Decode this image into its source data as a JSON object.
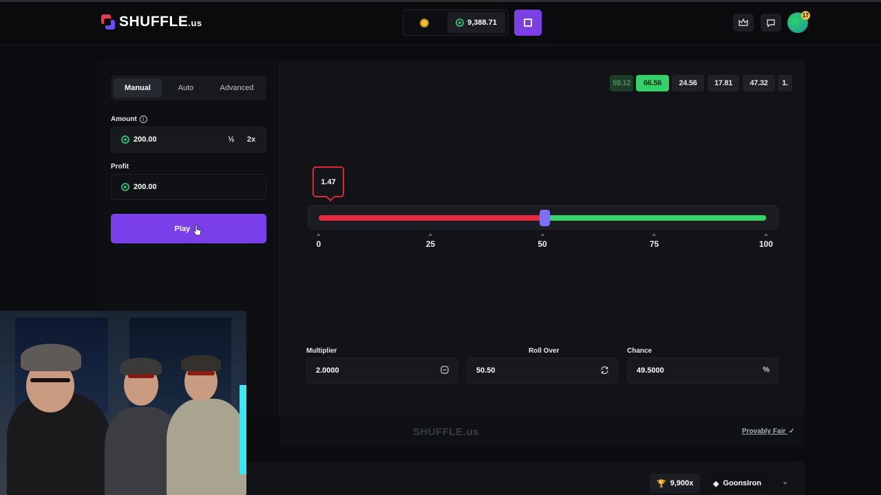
{
  "brand": {
    "name": "SHUFFLE",
    "suffix": ".us"
  },
  "wallet": {
    "balance": "9,388.71"
  },
  "avatar": {
    "level_badge": "17"
  },
  "sidebar": {
    "tabs": [
      "Manual",
      "Auto",
      "Advanced"
    ],
    "amount_label": "Amount",
    "amount_value": "200.00",
    "half_label": "½",
    "double_label": "2x",
    "profit_label": "Profit",
    "profit_value": "200.00",
    "play_label": "Play"
  },
  "history": [
    {
      "value": "59.12",
      "state": "faded"
    },
    {
      "value": "66.56",
      "state": "win"
    },
    {
      "value": "24.56",
      "state": "loss"
    },
    {
      "value": "17.81",
      "state": "loss"
    },
    {
      "value": "47.32",
      "state": "loss"
    },
    {
      "value": "1.",
      "state": "loss"
    }
  ],
  "slider": {
    "result": "1.47",
    "roll_over": 50.5,
    "ticks": [
      "0",
      "25",
      "50",
      "75",
      "100"
    ],
    "colors": {
      "lose": "#e8283d",
      "win": "#35d26a",
      "knob": "#7b6ff2"
    }
  },
  "controls": {
    "multiplier_label": "Multiplier",
    "multiplier_value": "2.0000",
    "rollover_label": "Roll Over",
    "rollover_value": "50.50",
    "chance_label": "Chance",
    "chance_value": "49.5000",
    "chance_suffix": "%"
  },
  "footer": {
    "logo": "SHUFFLE.us",
    "provably_fair": "Provably Fair"
  },
  "bottom": {
    "multiplier_pill": "9,900x",
    "user_pill": "GoonsIron"
  }
}
